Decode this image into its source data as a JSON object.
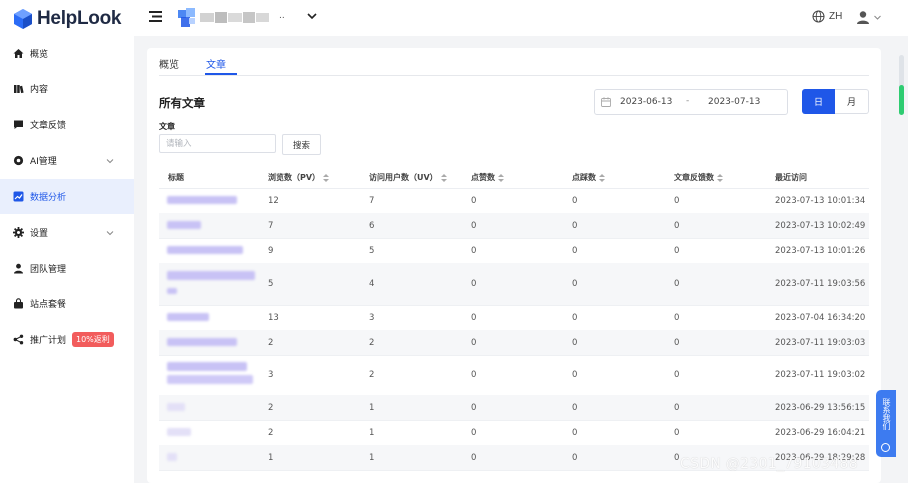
{
  "app": {
    "brand": "HelpLook",
    "space_suffix": "..",
    "language": "ZH"
  },
  "sidebar": {
    "items": [
      {
        "label": "概览",
        "icon": "home-icon"
      },
      {
        "label": "内容",
        "icon": "book-icon"
      },
      {
        "label": "文章反馈",
        "icon": "comment-icon"
      },
      {
        "label": "AI管理",
        "icon": "ai-icon",
        "expandable": true
      },
      {
        "label": "数据分析",
        "icon": "chart-icon",
        "active": true
      },
      {
        "label": "设置",
        "icon": "gear-icon",
        "expandable": true
      },
      {
        "label": "团队管理",
        "icon": "user-icon"
      },
      {
        "label": "站点套餐",
        "icon": "bag-icon"
      },
      {
        "label": "推广计划",
        "icon": "share-icon",
        "badge": "10%返利"
      }
    ]
  },
  "tabs": [
    {
      "label": "概览",
      "active": false
    },
    {
      "label": "文章",
      "active": true
    }
  ],
  "main": {
    "section_title": "所有文章",
    "filter_label": "文章",
    "search_placeholder": "请输入",
    "search_button": "搜索",
    "date_start": "2023-06-13",
    "date_sep": "-",
    "date_end": "2023-07-13",
    "granularity_day": "日",
    "granularity_month": "月"
  },
  "table": {
    "columns": [
      "标题",
      "浏览数（PV）",
      "访问用户数（UV）",
      "点赞数",
      "点踩数",
      "文章反馈数",
      "最近访问"
    ],
    "rows": [
      {
        "pv": "12",
        "uv": "7",
        "likes": "0",
        "dislikes": "0",
        "feedback": "0",
        "last": "2023-07-13 10:01:34"
      },
      {
        "pv": "7",
        "uv": "6",
        "likes": "0",
        "dislikes": "0",
        "feedback": "0",
        "last": "2023-07-13 10:02:49"
      },
      {
        "pv": "9",
        "uv": "5",
        "likes": "0",
        "dislikes": "0",
        "feedback": "0",
        "last": "2023-07-13 10:01:26"
      },
      {
        "pv": "5",
        "uv": "4",
        "likes": "0",
        "dislikes": "0",
        "feedback": "0",
        "last": "2023-07-11 19:03:56"
      },
      {
        "pv": "13",
        "uv": "3",
        "likes": "0",
        "dislikes": "0",
        "feedback": "0",
        "last": "2023-07-04 16:34:20"
      },
      {
        "pv": "2",
        "uv": "2",
        "likes": "0",
        "dislikes": "0",
        "feedback": "0",
        "last": "2023-07-11 19:03:03"
      },
      {
        "pv": "3",
        "uv": "2",
        "likes": "0",
        "dislikes": "0",
        "feedback": "0",
        "last": "2023-07-11 19:03:02"
      },
      {
        "pv": "2",
        "uv": "1",
        "likes": "0",
        "dislikes": "0",
        "feedback": "0",
        "last": "2023-06-29 13:56:15"
      },
      {
        "pv": "2",
        "uv": "1",
        "likes": "0",
        "dislikes": "0",
        "feedback": "0",
        "last": "2023-06-29 16:04:21"
      },
      {
        "pv": "1",
        "uv": "1",
        "likes": "0",
        "dislikes": "0",
        "feedback": "0",
        "last": "2023-06-29 18:29:28"
      }
    ]
  },
  "support": {
    "label": "联系我们"
  },
  "watermark": "CSDN @2301_79103488",
  "colors": {
    "accent": "#1f57e8",
    "active_bg": "#e9effd",
    "badge": "#f25c5c",
    "support": "#3d7bf0",
    "redaction": "#c8c2f5"
  }
}
